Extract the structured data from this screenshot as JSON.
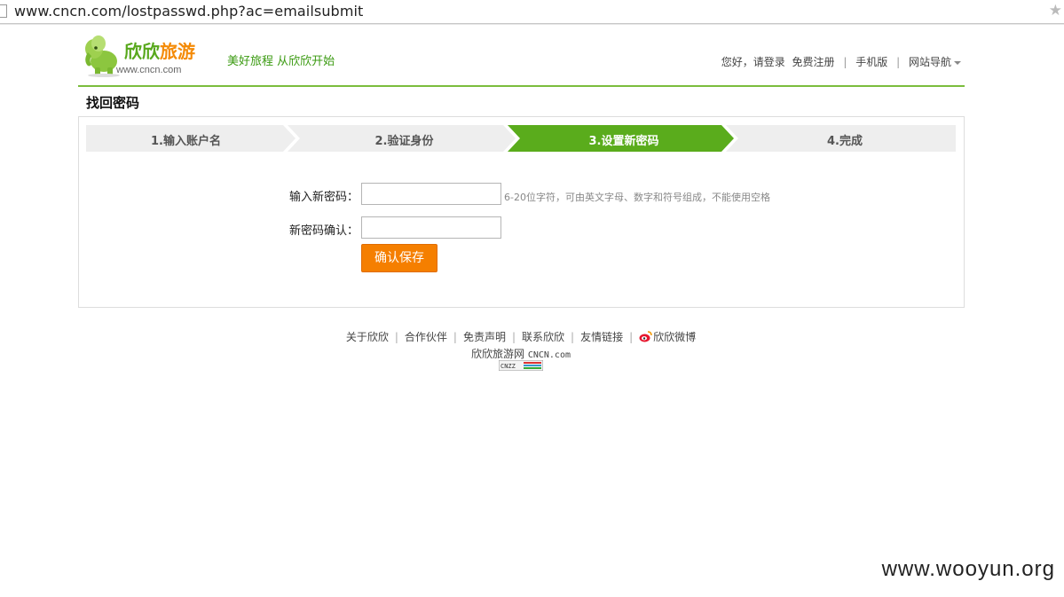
{
  "browser": {
    "url": "www.cncn.com/lostpasswd.php?ac=emailsubmit"
  },
  "header": {
    "brand_green": "欣欣",
    "brand_orange": "旅游",
    "site": "www.cncn.com",
    "slogan": "美好旅程 从欣欣开始",
    "greeting": "您好，请登录",
    "register": "免费注册",
    "mobile": "手机版",
    "nav": "网站导航"
  },
  "page_title": "找回密码",
  "steps": [
    {
      "label": "1.输入账户名"
    },
    {
      "label": "2.验证身份"
    },
    {
      "label": "3.设置新密码"
    },
    {
      "label": "4.完成"
    }
  ],
  "active_step": 3,
  "form": {
    "new_password_label": "输入新密码：",
    "new_password_value": "",
    "new_password_hint": "6-20位字符，可由英文字母、数字和符号组成，不能使用空格",
    "confirm_label": "新密码确认：",
    "confirm_value": "",
    "save_label": "确认保存"
  },
  "footer": {
    "links": [
      "关于欣欣",
      "合作伙伴",
      "免责声明",
      "联系欣欣",
      "友情链接",
      "欣欣微博"
    ],
    "copyright_cn": "欣欣旅游网",
    "copyright_domain": "CNCN.com",
    "cnzz_badge": "CNZZ"
  },
  "watermark": "www.wooyun.org",
  "colors": {
    "brand_green": "#58a81c",
    "brand_orange": "#f48a06",
    "step_active": "#5aac1c",
    "step_inactive": "#eeeeee",
    "button": "#f57f00"
  },
  "icons": {
    "logo": "elephant-logo-icon",
    "weibo": "weibo-icon",
    "bookmark": "star-icon"
  }
}
